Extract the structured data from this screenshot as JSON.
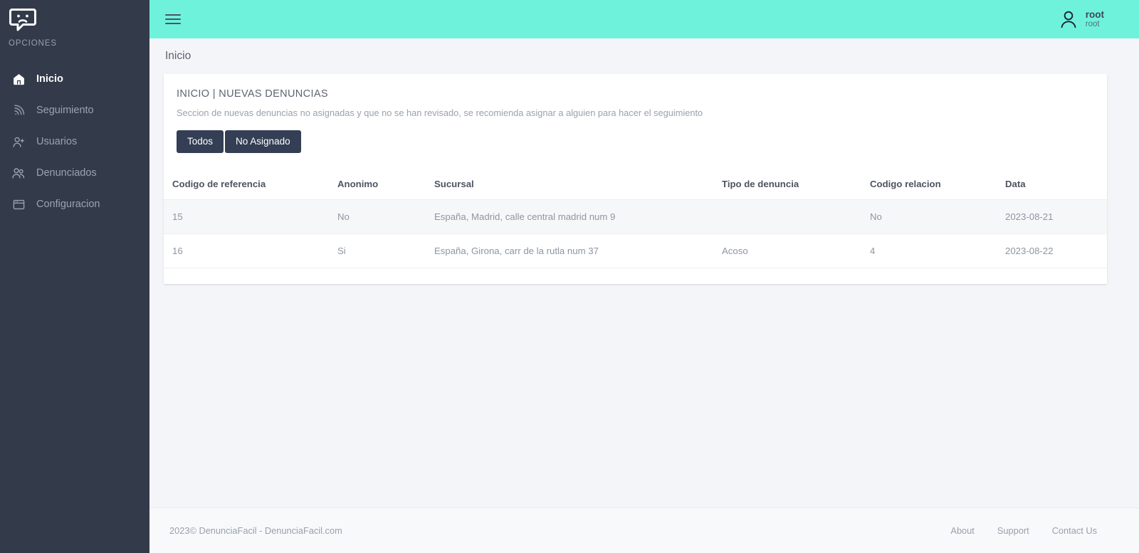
{
  "sidebar": {
    "logo_icon": "sad-speech-bubble-logo",
    "section_label": "OPCIONES",
    "items": [
      {
        "label": "Inicio",
        "icon": "home-icon",
        "active": true
      },
      {
        "label": "Seguimiento",
        "icon": "rss-icon",
        "active": false
      },
      {
        "label": "Usuarios",
        "icon": "user-add-icon",
        "active": false
      },
      {
        "label": "Denunciados",
        "icon": "users-icon",
        "active": false
      },
      {
        "label": "Configuracion",
        "icon": "window-icon",
        "active": false
      }
    ]
  },
  "topbar": {
    "menu_icon": "hamburger-icon",
    "avatar_icon": "user-avatar-icon",
    "user_name": "root",
    "user_role": "root",
    "background_color": "#6ff2dc"
  },
  "breadcrumb": {
    "text": "Inicio"
  },
  "card": {
    "title": "INICIO | NUEVAS DENUNCIAS",
    "subtitle": "Seccion de nuevas denuncias no asignadas y que no se han revisado, se recomienda asignar a alguien para hacer el seguimiento",
    "buttons": [
      {
        "label": "Todos"
      },
      {
        "label": "No Asignado"
      }
    ],
    "button_color": "#343e54"
  },
  "table": {
    "columns": [
      "Codigo de referencia",
      "Anonimo",
      "Sucursal",
      "Tipo de denuncia",
      "Codigo relacion",
      "Data"
    ],
    "rows": [
      {
        "codigo_referencia": "15",
        "anonimo": "No",
        "sucursal": "España, Madrid, calle central madrid num 9",
        "tipo_denuncia": "",
        "codigo_relacion": "No",
        "data": "2023-08-21"
      },
      {
        "codigo_referencia": "16",
        "anonimo": "Si",
        "sucursal": "España, Girona, carr de la rutla num 37",
        "tipo_denuncia": "Acoso",
        "codigo_relacion": "4",
        "data": "2023-08-22"
      }
    ]
  },
  "footer": {
    "copyright": "2023© DenunciaFacil - DenunciaFacil.com",
    "links": [
      {
        "label": "About"
      },
      {
        "label": "Support"
      },
      {
        "label": "Contact Us"
      }
    ]
  }
}
